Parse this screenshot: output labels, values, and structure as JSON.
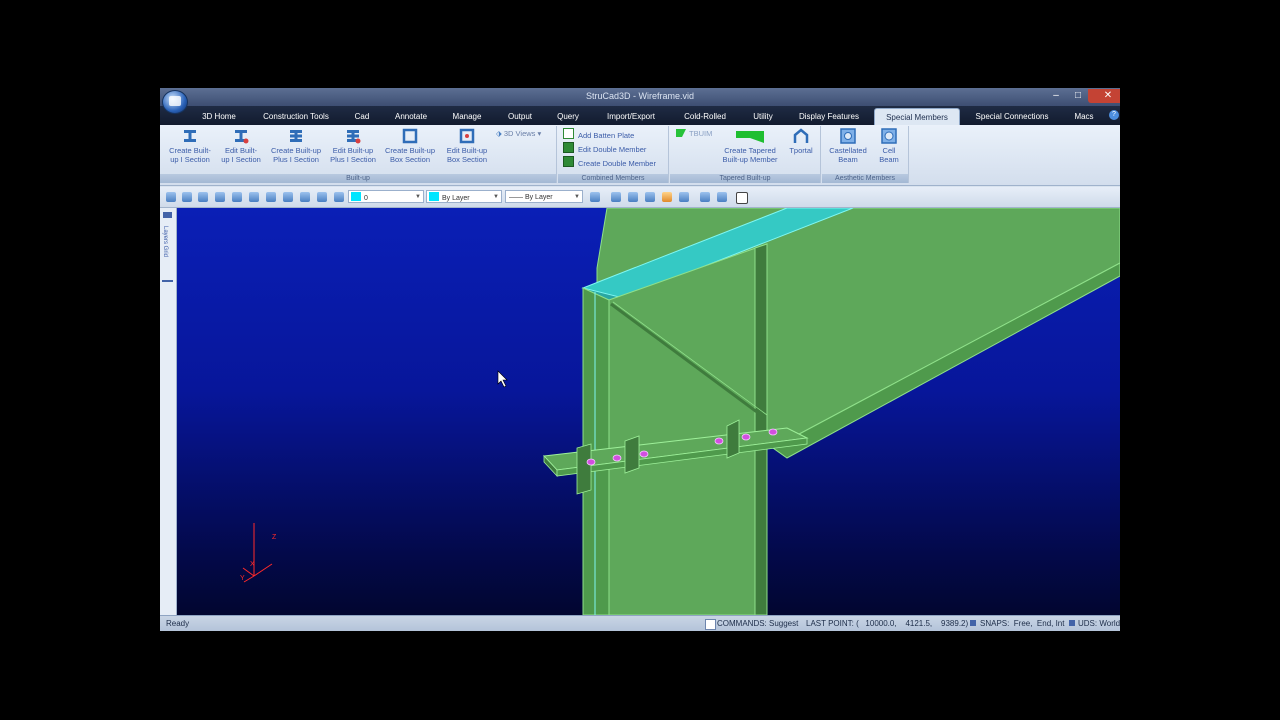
{
  "window": {
    "title": "StruCad3D - Wireframe.vid",
    "controls": [
      "–",
      "□",
      "✕"
    ]
  },
  "tabs": [
    {
      "label": "3D Home"
    },
    {
      "label": "Construction Tools"
    },
    {
      "label": "Cad"
    },
    {
      "label": "Annotate"
    },
    {
      "label": "Manage"
    },
    {
      "label": "Output"
    },
    {
      "label": "Query"
    },
    {
      "label": "Import/Export"
    },
    {
      "label": "Cold-Rolled"
    },
    {
      "label": "Utility"
    },
    {
      "label": "Display Features"
    },
    {
      "label": "Special Members",
      "active": true
    },
    {
      "label": "Special Connections"
    },
    {
      "label": "Macs"
    }
  ],
  "ribbon": {
    "builtup": {
      "label": "Built-up",
      "buttons": [
        {
          "line1": "Create Built-",
          "line2": "up I Section"
        },
        {
          "line1": "Edit Built-",
          "line2": "up I Section"
        },
        {
          "line1": "Create Built-up",
          "line2": "Plus I Section"
        },
        {
          "line1": "Edit Built-up",
          "line2": "Plus I Section"
        },
        {
          "line1": "Create Built-up",
          "line2": "Box Section"
        },
        {
          "line1": "Edit Built-up",
          "line2": "Box Section"
        }
      ],
      "views_dropdown": "3D Views"
    },
    "combined": {
      "label": "Combined Members",
      "items": [
        "Add Batten Plate",
        "Edit Double Member",
        "Create Double Member"
      ]
    },
    "tapered": {
      "label": "Tapered Built-up",
      "tbuim": "TBUIM",
      "buttons": [
        {
          "line1": "Create Tapered",
          "line2": "Built-up Member"
        },
        {
          "line1": "Tportal",
          "line2": ""
        }
      ]
    },
    "aesthetic": {
      "label": "Aesthetic Members",
      "buttons": [
        {
          "line1": "Castellated",
          "line2": "Beam"
        },
        {
          "line1": "Cell",
          "line2": "Beam"
        }
      ]
    }
  },
  "toolbar": {
    "layer_value": "0",
    "color_value": "By Layer",
    "linetype_value": "—— By Layer"
  },
  "side_panel": {
    "label": "Layers Grid"
  },
  "status": {
    "ready": "Ready",
    "commands": "COMMANDS: Suggest",
    "last_point": "LAST POINT: (   10000.0,    4121.5,    9389.2)",
    "snaps": "SNAPS:  Free,  End, Int",
    "uds": "UDS: World"
  },
  "colors": {
    "viewport_top": "#0a1fb6",
    "member_fill": "#5ea85a",
    "member_edge": "#8fe08a",
    "flange_cyan": "#35c9c4",
    "bolt": "#d24fe0"
  }
}
